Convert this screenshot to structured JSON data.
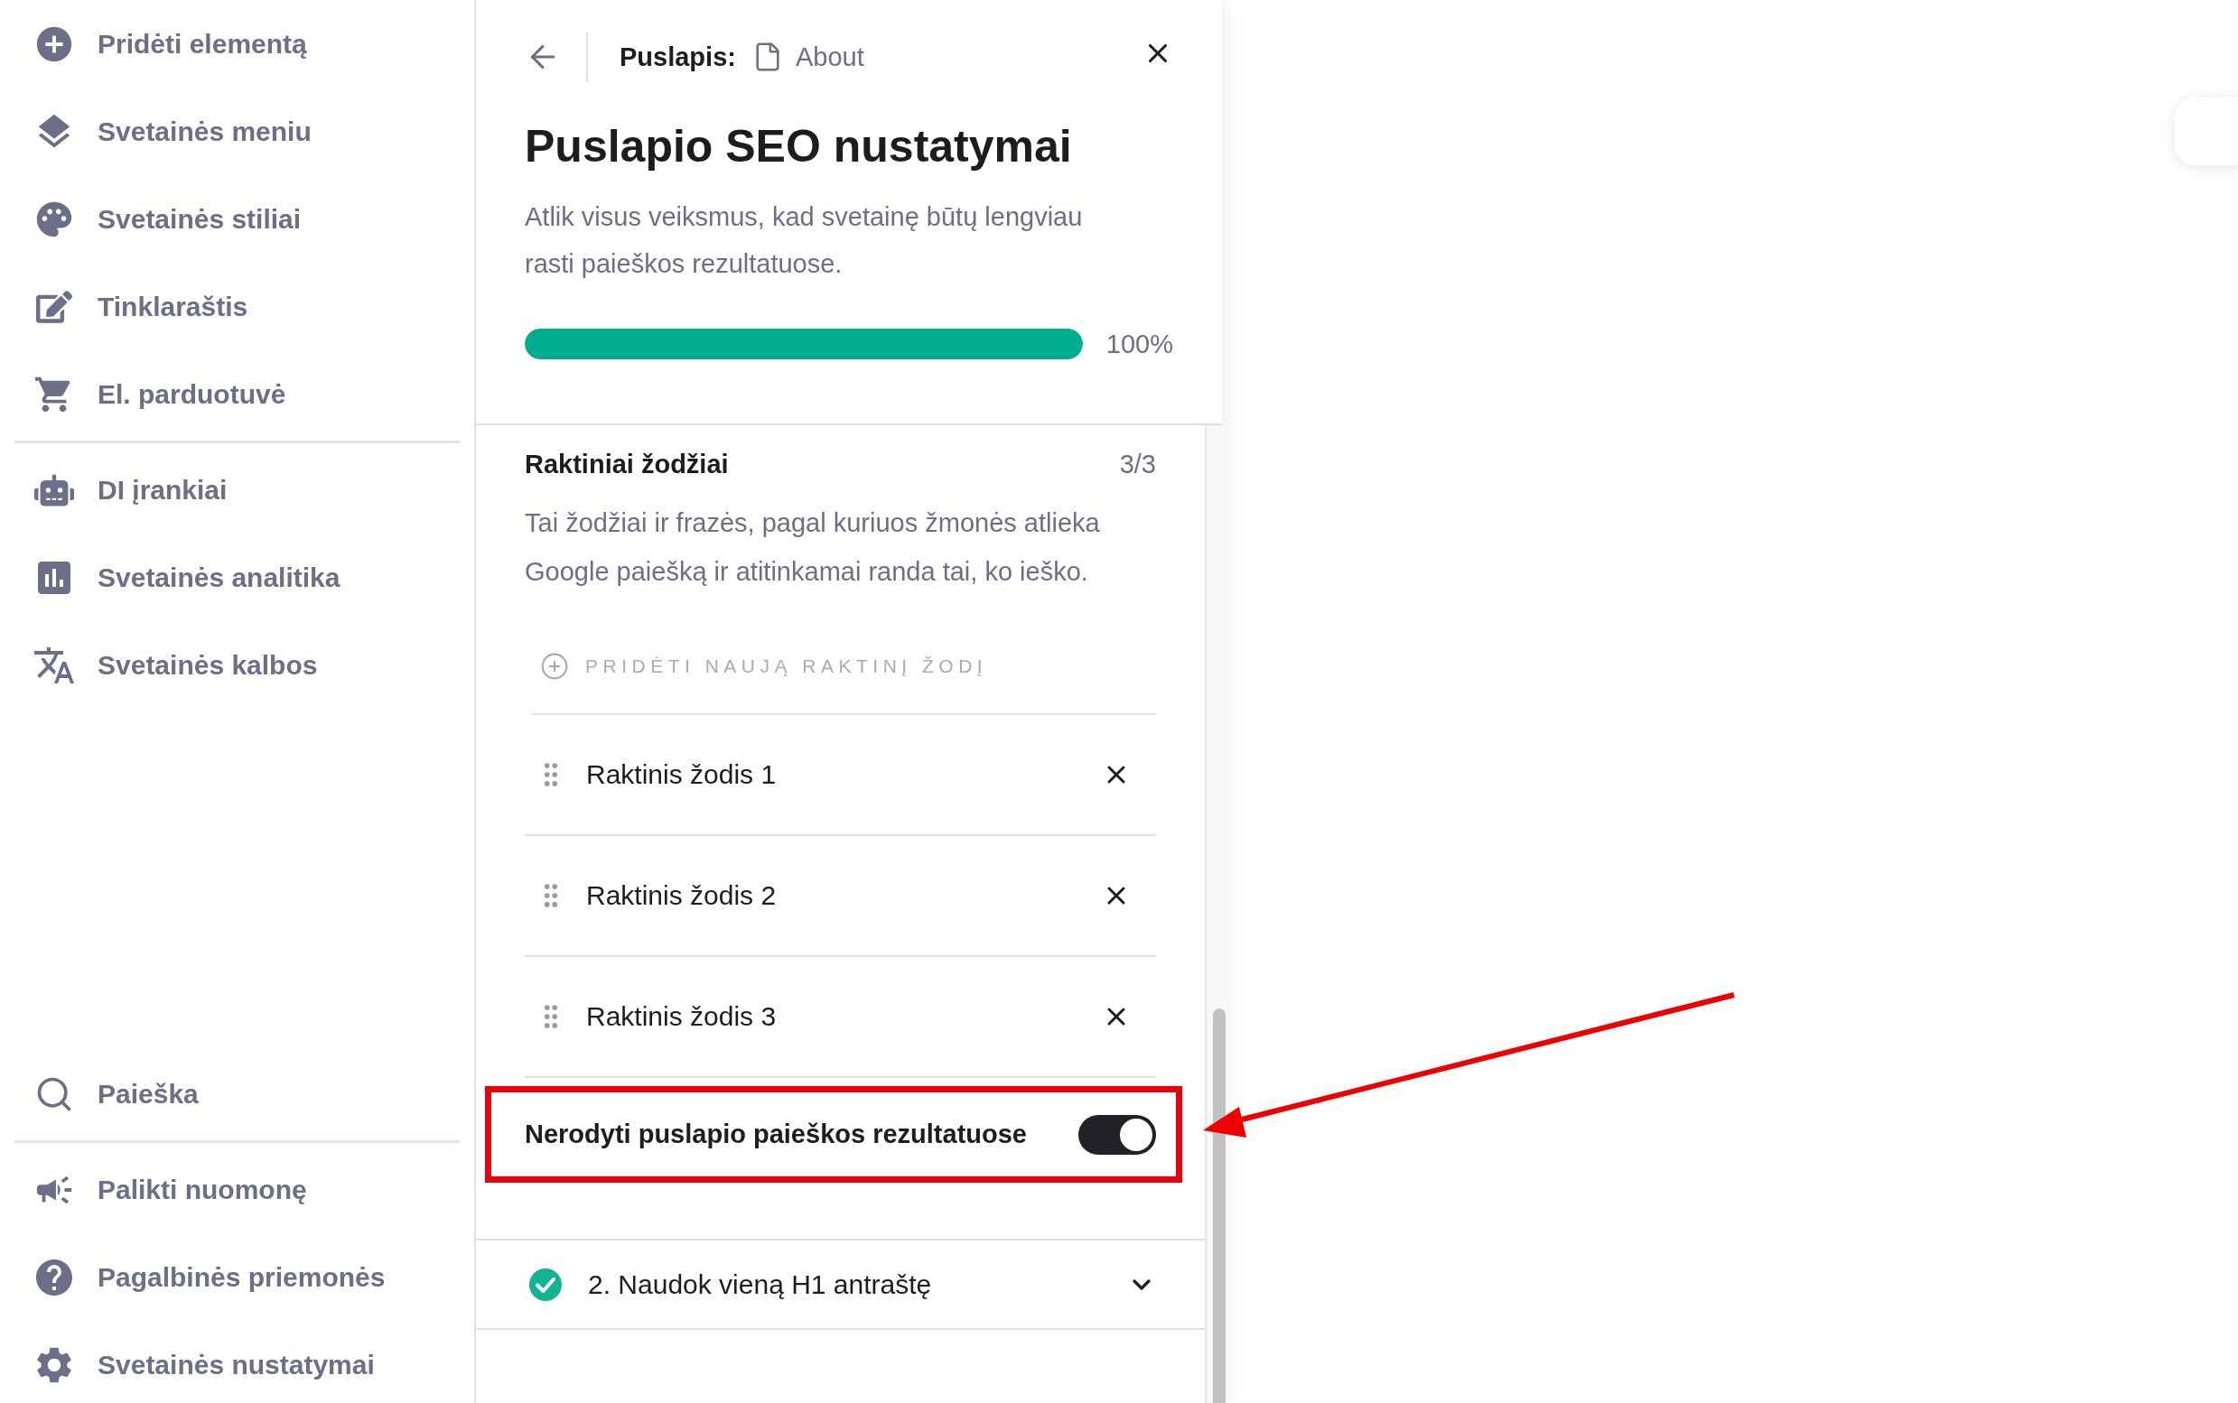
{
  "sidebar_groups": [
    [
      "Pridėti elementą",
      "Svetainės meniu",
      "Svetainės stiliai",
      "Tinklaraštis",
      "El. parduotuvė"
    ],
    [
      "DI įrankiai",
      "Svetainės analitika",
      "Svetainės kalbos"
    ],
    [
      "Paieška"
    ],
    [
      "Palikti nuomonę",
      "Pagalbinės priemonės",
      "Svetainės nustatymai"
    ]
  ],
  "panel": {
    "breadcrumb_label": "Puslapis:",
    "page_name": "About",
    "title": "Puslapio SEO nustatymai",
    "description": "Atlik visus veiksmus, kad svetainę būtų lengviau rasti paieškos rezultatuose.",
    "progress": {
      "level": 1,
      "reading": "100%"
    },
    "keywords_section": {
      "title": "Raktiniai žodžiai",
      "count": "3/3",
      "description": "Tai žodžiai ir frazės, pagal kuriuos žmonės atlieka Google paiešką ir atitinkamai randa tai, ko ieško.",
      "add_button": {
        "label": "PRIDĖTI NAUJĄ RAKTINĮ ŽODĮ",
        "disabled": true
      },
      "keywords": [
        "Raktinis žodis 1",
        "Raktinis žodis 2",
        "Raktinis žodis 3"
      ]
    },
    "noindex_toggle": {
      "label": "Nerodyti puslapio paieškos rezultatuose",
      "on": true
    },
    "checklist": [
      {
        "label": "2. Naudok vieną H1 antraštę",
        "done": true,
        "expanded": false
      }
    ]
  }
}
